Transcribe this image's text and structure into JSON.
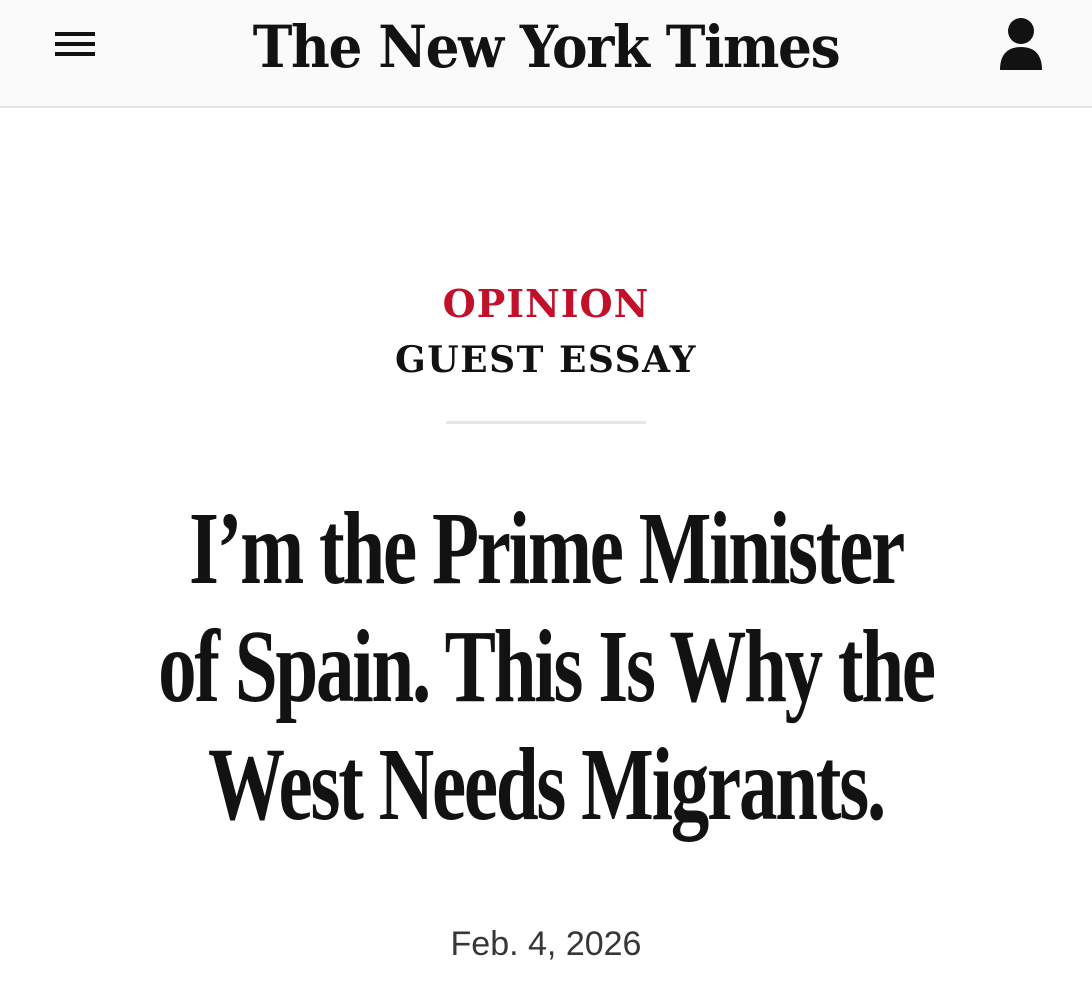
{
  "header": {
    "logo_text": "The New York Times",
    "menu_icon": "hamburger-menu-icon",
    "account_icon": "user-account-icon"
  },
  "article": {
    "section": "OPINION",
    "subsection": "GUEST ESSAY",
    "headline_lines": [
      "I’m the Prime Minister",
      "of Spain. This Is Why the",
      "West Needs Migrants."
    ],
    "date": "Feb. 4, 2026"
  },
  "colors": {
    "accent_red": "#c2102a",
    "text": "#121212",
    "header_bg": "#fafafa"
  }
}
